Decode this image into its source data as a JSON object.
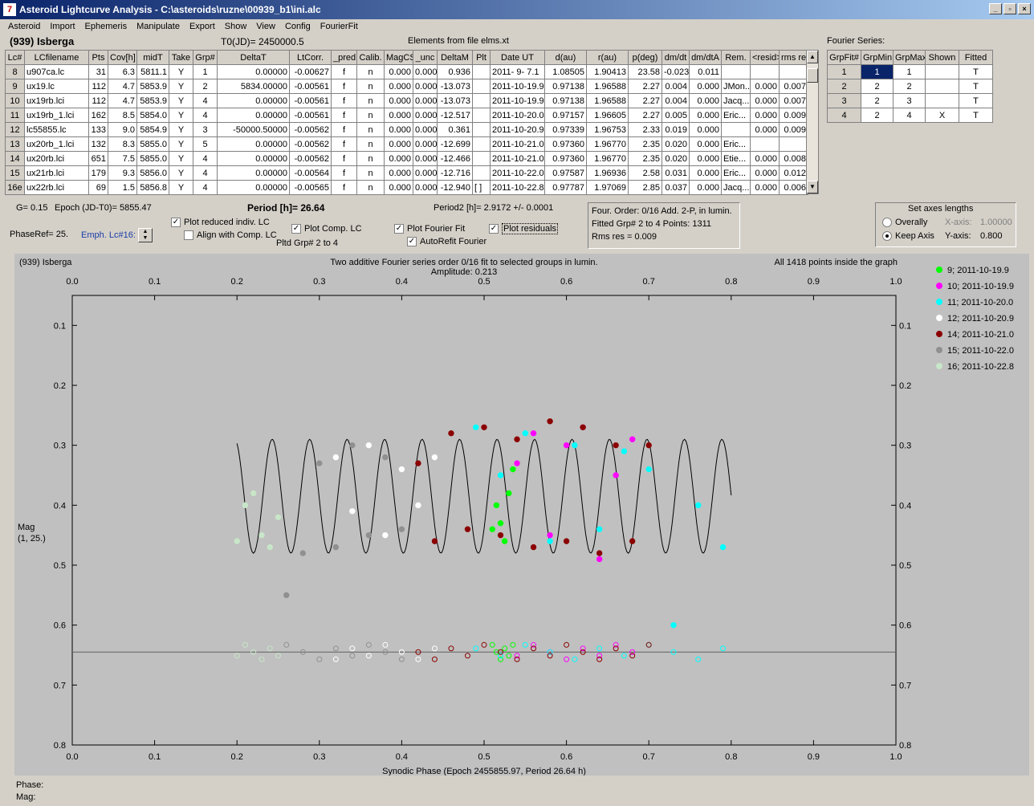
{
  "window": {
    "title": "Asteroid Lightcurve Analysis - C:\\asteroids\\ruzne\\00939_b1\\ini.alc",
    "icon": "app-logo-icon"
  },
  "menu": [
    "Asteroid",
    "Import",
    "Ephemeris",
    "Manipulate",
    "Export",
    "Show",
    "View",
    "Config",
    "FourierFit"
  ],
  "header": {
    "asteroid": "(939) Isberga",
    "t0": "T0(JD)= 2450000.5",
    "elements": "Elements from file elms.xt"
  },
  "lc_table": {
    "columns": [
      "Lc#",
      "LCfilename",
      "Pts",
      "Cov[h]",
      "midT",
      "Take",
      "Grp#",
      "DeltaT",
      "LtCorr.",
      "_pred",
      "Calib.",
      "MagCS",
      "_unc",
      "DeltaM",
      "Plt",
      "Date UT",
      "d(au)",
      "r(au)",
      "p(deg)",
      "dm/dt",
      "dm/dtA",
      "Rem.",
      "<resid>",
      "rms res"
    ],
    "rows": [
      [
        "8",
        "u907ca.lc",
        "31",
        "6.3",
        "5811.1",
        "Y",
        "1",
        "0.00000",
        "-0.00627",
        "f",
        "n",
        "0.000",
        "0.000",
        "0.936",
        "",
        "2011- 9- 7.1",
        "1.08505",
        "1.90413",
        "23.58",
        "-0.023",
        "0.011",
        "",
        "",
        ""
      ],
      [
        "9",
        "ux19.lc",
        "112",
        "4.7",
        "5853.9",
        "Y",
        "2",
        "5834.00000",
        "-0.00561",
        "f",
        "n",
        "0.000",
        "0.000",
        "-13.073",
        "",
        "2011-10-19.9",
        "0.97138",
        "1.96588",
        "2.27",
        "0.004",
        "0.000",
        "JMon..",
        "0.000",
        "0.007"
      ],
      [
        "10",
        "ux19rb.lci",
        "112",
        "4.7",
        "5853.9",
        "Y",
        "4",
        "0.00000",
        "-0.00561",
        "f",
        "n",
        "0.000",
        "0.000",
        "-13.073",
        "",
        "2011-10-19.9",
        "0.97138",
        "1.96588",
        "2.27",
        "0.004",
        "0.000",
        "Jacq...",
        "0.000",
        "0.007"
      ],
      [
        "11",
        "ux19rb_1.lci",
        "162",
        "8.5",
        "5854.0",
        "Y",
        "4",
        "0.00000",
        "-0.00561",
        "f",
        "n",
        "0.000",
        "0.000",
        "-12.517",
        "",
        "2011-10-20.0",
        "0.97157",
        "1.96605",
        "2.27",
        "0.005",
        "0.000",
        "Eric...",
        "0.000",
        "0.009"
      ],
      [
        "12",
        "lc55855.lc",
        "133",
        "9.0",
        "5854.9",
        "Y",
        "3",
        "-50000.50000",
        "-0.00562",
        "f",
        "n",
        "0.000",
        "0.000",
        "0.361",
        "",
        "2011-10-20.9",
        "0.97339",
        "1.96753",
        "2.33",
        "0.019",
        "0.000",
        "",
        "0.000",
        "0.009"
      ],
      [
        "13",
        "ux20rb_1.lci",
        "132",
        "8.3",
        "5855.0",
        "Y",
        "5",
        "0.00000",
        "-0.00562",
        "f",
        "n",
        "0.000",
        "0.000",
        "-12.699",
        "",
        "2011-10-21.0",
        "0.97360",
        "1.96770",
        "2.35",
        "0.020",
        "0.000",
        "Eric...",
        "",
        ""
      ],
      [
        "14",
        "ux20rb.lci",
        "651",
        "7.5",
        "5855.0",
        "Y",
        "4",
        "0.00000",
        "-0.00562",
        "f",
        "n",
        "0.000",
        "0.000",
        "-12.466",
        "",
        "2011-10-21.0",
        "0.97360",
        "1.96770",
        "2.35",
        "0.020",
        "0.000",
        "Etie...",
        "0.000",
        "0.008"
      ],
      [
        "15",
        "ux21rb.lci",
        "179",
        "9.3",
        "5856.0",
        "Y",
        "4",
        "0.00000",
        "-0.00564",
        "f",
        "n",
        "0.000",
        "0.000",
        "-12.716",
        "",
        "2011-10-22.0",
        "0.97587",
        "1.96936",
        "2.58",
        "0.031",
        "0.000",
        "Eric...",
        "0.000",
        "0.012"
      ],
      [
        "16e",
        "ux22rb.lci",
        "69",
        "1.5",
        "5856.8",
        "Y",
        "4",
        "0.00000",
        "-0.00565",
        "f",
        "n",
        "0.000",
        "0.000",
        "-12.940",
        "[ ]",
        "2011-10-22.8",
        "0.97787",
        "1.97069",
        "2.85",
        "0.037",
        "0.000",
        "Jacq...",
        "0.000",
        "0.006"
      ]
    ]
  },
  "fourier_series": {
    "label": "Fourier Series:",
    "columns": [
      "GrpFit#",
      "GrpMin",
      "GrpMax",
      "Shown",
      "Fitted"
    ],
    "rows": [
      [
        "1",
        "1",
        "1",
        "",
        "T"
      ],
      [
        "2",
        "2",
        "2",
        "",
        "T"
      ],
      [
        "3",
        "2",
        "3",
        "",
        "T"
      ],
      [
        "4",
        "2",
        "4",
        "X",
        "T"
      ]
    ]
  },
  "controls": {
    "g": "G= 0.15",
    "epoch": "Epoch (JD-T0)= 5855.47",
    "period_label": "Period [h]= 26.64",
    "period2": "Period2 [h]= 2.9172 +/- 0.0001",
    "phaseref": "PhaseRef= 25.",
    "emph": "Emph. Lc#16:",
    "plot_reduced": "Plot reduced indiv. LC",
    "align": "Align with Comp. LC",
    "plot_comp": "Plot Comp. LC",
    "pltd_grp": "Pltd Grp#  2   to   4",
    "plot_fourier": "Plot Fourier Fit",
    "autorefit": "AutoRefit Fourier",
    "plot_residuals": "Plot residuals",
    "info": [
      "Four. Order:  0/16    Add. 2-P, in lumin.",
      "Fitted Grp# 2 to 4      Points: 1311",
      "Rms res      = 0.009"
    ],
    "axes_title": "Set axes lengths",
    "overally": "Overally",
    "keep_axis": "Keep Axis",
    "x_axis": "X-axis:",
    "x_val": "1.00000",
    "y_axis": "Y-axis:",
    "y_val": "0.800"
  },
  "chart_data": {
    "type": "scatter",
    "title": "Two additive Fourier series order 0/16 fit to selected groups in lumin.",
    "subtitle": "Amplitude: 0.213",
    "top_left": "(939) Isberga",
    "top_right": "All 1418 points inside the graph",
    "xlabel": "Synodic Phase (Epoch 2455855.97, Period 26.64 h)",
    "ylabel": "Mag",
    "ylabel2": "(1, 25.)",
    "xlim": [
      0.0,
      1.0
    ],
    "ylim": [
      0.8,
      0.05
    ],
    "xticks": [
      "0.0",
      "0.1",
      "0.2",
      "0.3",
      "0.4",
      "0.5",
      "0.6",
      "0.7",
      "0.8",
      "0.9",
      "1.0"
    ],
    "yticks": [
      "0.1",
      "0.2",
      "0.3",
      "0.4",
      "0.5",
      "0.6",
      "0.7",
      "0.8"
    ],
    "residual_baseline": 0.645,
    "legend_position": "right",
    "series": [
      {
        "name": "9; 2011-10-19.9",
        "color": "#00ff00",
        "x": [
          0.51,
          0.515,
          0.52,
          0.525,
          0.53,
          0.535
        ],
        "y": [
          0.44,
          0.4,
          0.43,
          0.46,
          0.38,
          0.34
        ]
      },
      {
        "name": "10; 2011-10-19.9",
        "color": "#ff00ff",
        "x": [
          0.54,
          0.56,
          0.58,
          0.6,
          0.62,
          0.64,
          0.66,
          0.68
        ],
        "y": [
          0.33,
          0.28,
          0.45,
          0.3,
          0.27,
          0.49,
          0.35,
          0.29
        ]
      },
      {
        "name": "11; 2011-10-20.0",
        "color": "#00ffff",
        "x": [
          0.49,
          0.52,
          0.55,
          0.58,
          0.61,
          0.64,
          0.67,
          0.7,
          0.73,
          0.76,
          0.79
        ],
        "y": [
          0.27,
          0.35,
          0.28,
          0.46,
          0.3,
          0.44,
          0.31,
          0.34,
          0.6,
          0.4,
          0.47
        ]
      },
      {
        "name": "12; 2011-10-20.9",
        "color": "#ffffff",
        "x": [
          0.32,
          0.34,
          0.36,
          0.38,
          0.4,
          0.42,
          0.44
        ],
        "y": [
          0.32,
          0.41,
          0.3,
          0.45,
          0.34,
          0.4,
          0.32
        ]
      },
      {
        "name": "14; 2011-10-21.0",
        "color": "#8b0000",
        "x": [
          0.42,
          0.44,
          0.46,
          0.48,
          0.5,
          0.52,
          0.54,
          0.56,
          0.58,
          0.6,
          0.62,
          0.64,
          0.66,
          0.68,
          0.7
        ],
        "y": [
          0.33,
          0.46,
          0.28,
          0.44,
          0.27,
          0.45,
          0.29,
          0.47,
          0.26,
          0.46,
          0.27,
          0.48,
          0.3,
          0.46,
          0.3
        ]
      },
      {
        "name": "15; 2011-10-22.0",
        "color": "#909090",
        "x": [
          0.26,
          0.28,
          0.3,
          0.32,
          0.34,
          0.36,
          0.38,
          0.4
        ],
        "y": [
          0.55,
          0.48,
          0.33,
          0.47,
          0.3,
          0.45,
          0.32,
          0.44
        ]
      },
      {
        "name": "16; 2011-10-22.8",
        "color": "#c8e6c8",
        "x": [
          0.2,
          0.21,
          0.22,
          0.23,
          0.24,
          0.25
        ],
        "y": [
          0.46,
          0.4,
          0.38,
          0.45,
          0.47,
          0.42
        ]
      }
    ]
  },
  "status": {
    "phase": "Phase:",
    "mag": "Mag:"
  }
}
